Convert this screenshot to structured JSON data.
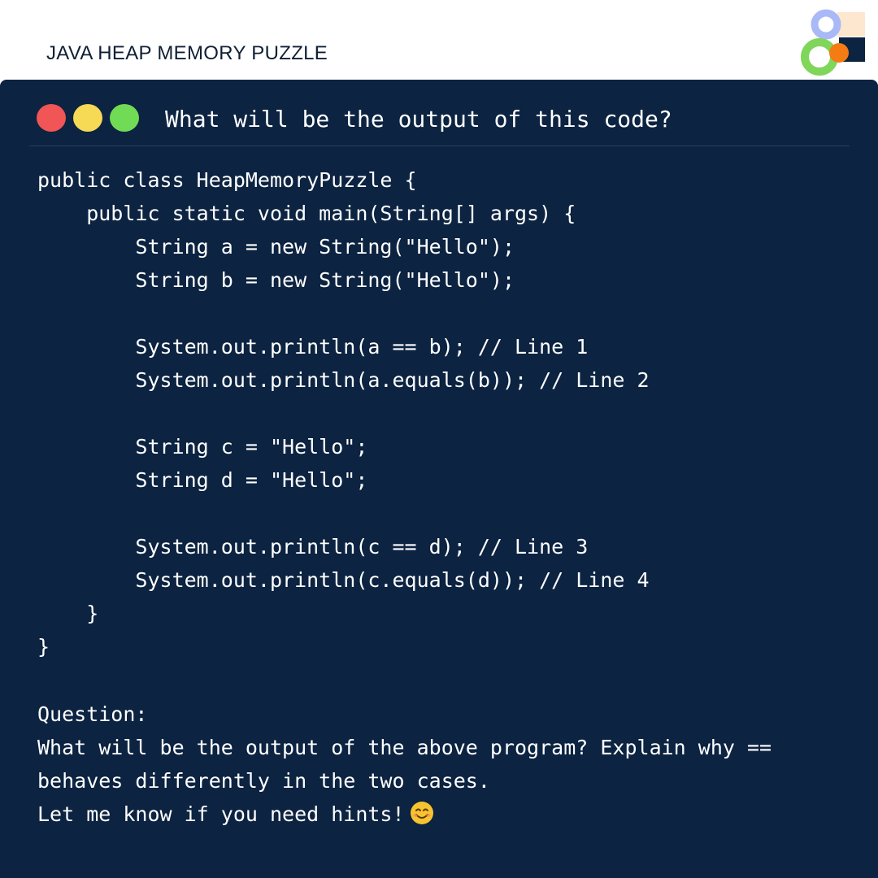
{
  "header": {
    "title": "JAVA HEAP MEMORY PUZZLE",
    "logo_icon": "brand-logo-icon"
  },
  "window": {
    "title": "What will be the output of this code?",
    "controls": [
      "close-dot",
      "minimize-dot",
      "maximize-dot"
    ],
    "colors": {
      "background": "#0c2341",
      "red": "#f15555",
      "yellow": "#f6d955",
      "green": "#71db55"
    }
  },
  "code": {
    "lines": [
      "public class HeapMemoryPuzzle {",
      "    public static void main(String[] args) {",
      "        String a = new String(\"Hello\");",
      "        String b = new String(\"Hello\");",
      "",
      "        System.out.println(a == b); // Line 1",
      "        System.out.println(a.equals(b)); // Line 2",
      "",
      "        String c = \"Hello\";",
      "        String d = \"Hello\";",
      "",
      "        System.out.println(c == d); // Line 3",
      "        System.out.println(c.equals(d)); // Line 4",
      "    }",
      "}"
    ]
  },
  "question": {
    "heading": "Question:",
    "line1": "What will be the output of the above program? Explain why ==",
    "line2": "behaves differently in the two cases.",
    "line3": "Let me know if you need hints!",
    "emoji_icon": "smiling-face-emoji-icon"
  }
}
